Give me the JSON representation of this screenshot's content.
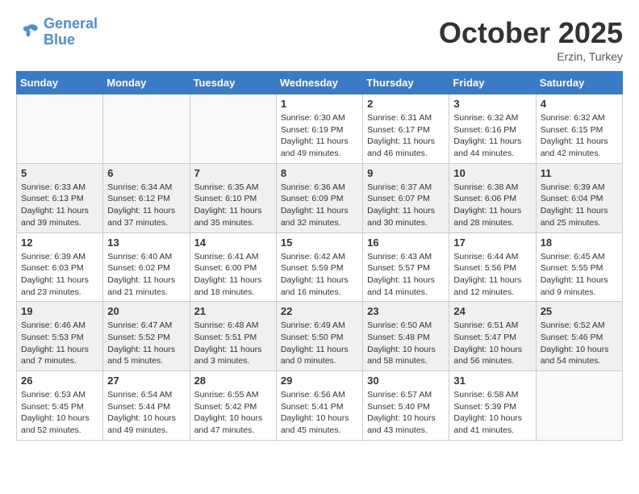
{
  "header": {
    "logo_line1": "General",
    "logo_line2": "Blue",
    "month": "October 2025",
    "location": "Erzin, Turkey"
  },
  "weekdays": [
    "Sunday",
    "Monday",
    "Tuesday",
    "Wednesday",
    "Thursday",
    "Friday",
    "Saturday"
  ],
  "weeks": [
    [
      {
        "day": "",
        "info": ""
      },
      {
        "day": "",
        "info": ""
      },
      {
        "day": "",
        "info": ""
      },
      {
        "day": "1",
        "info": "Sunrise: 6:30 AM\nSunset: 6:19 PM\nDaylight: 11 hours\nand 49 minutes."
      },
      {
        "day": "2",
        "info": "Sunrise: 6:31 AM\nSunset: 6:17 PM\nDaylight: 11 hours\nand 46 minutes."
      },
      {
        "day": "3",
        "info": "Sunrise: 6:32 AM\nSunset: 6:16 PM\nDaylight: 11 hours\nand 44 minutes."
      },
      {
        "day": "4",
        "info": "Sunrise: 6:32 AM\nSunset: 6:15 PM\nDaylight: 11 hours\nand 42 minutes."
      }
    ],
    [
      {
        "day": "5",
        "info": "Sunrise: 6:33 AM\nSunset: 6:13 PM\nDaylight: 11 hours\nand 39 minutes."
      },
      {
        "day": "6",
        "info": "Sunrise: 6:34 AM\nSunset: 6:12 PM\nDaylight: 11 hours\nand 37 minutes."
      },
      {
        "day": "7",
        "info": "Sunrise: 6:35 AM\nSunset: 6:10 PM\nDaylight: 11 hours\nand 35 minutes."
      },
      {
        "day": "8",
        "info": "Sunrise: 6:36 AM\nSunset: 6:09 PM\nDaylight: 11 hours\nand 32 minutes."
      },
      {
        "day": "9",
        "info": "Sunrise: 6:37 AM\nSunset: 6:07 PM\nDaylight: 11 hours\nand 30 minutes."
      },
      {
        "day": "10",
        "info": "Sunrise: 6:38 AM\nSunset: 6:06 PM\nDaylight: 11 hours\nand 28 minutes."
      },
      {
        "day": "11",
        "info": "Sunrise: 6:39 AM\nSunset: 6:04 PM\nDaylight: 11 hours\nand 25 minutes."
      }
    ],
    [
      {
        "day": "12",
        "info": "Sunrise: 6:39 AM\nSunset: 6:03 PM\nDaylight: 11 hours\nand 23 minutes."
      },
      {
        "day": "13",
        "info": "Sunrise: 6:40 AM\nSunset: 6:02 PM\nDaylight: 11 hours\nand 21 minutes."
      },
      {
        "day": "14",
        "info": "Sunrise: 6:41 AM\nSunset: 6:00 PM\nDaylight: 11 hours\nand 18 minutes."
      },
      {
        "day": "15",
        "info": "Sunrise: 6:42 AM\nSunset: 5:59 PM\nDaylight: 11 hours\nand 16 minutes."
      },
      {
        "day": "16",
        "info": "Sunrise: 6:43 AM\nSunset: 5:57 PM\nDaylight: 11 hours\nand 14 minutes."
      },
      {
        "day": "17",
        "info": "Sunrise: 6:44 AM\nSunset: 5:56 PM\nDaylight: 11 hours\nand 12 minutes."
      },
      {
        "day": "18",
        "info": "Sunrise: 6:45 AM\nSunset: 5:55 PM\nDaylight: 11 hours\nand 9 minutes."
      }
    ],
    [
      {
        "day": "19",
        "info": "Sunrise: 6:46 AM\nSunset: 5:53 PM\nDaylight: 11 hours\nand 7 minutes."
      },
      {
        "day": "20",
        "info": "Sunrise: 6:47 AM\nSunset: 5:52 PM\nDaylight: 11 hours\nand 5 minutes."
      },
      {
        "day": "21",
        "info": "Sunrise: 6:48 AM\nSunset: 5:51 PM\nDaylight: 11 hours\nand 3 minutes."
      },
      {
        "day": "22",
        "info": "Sunrise: 6:49 AM\nSunset: 5:50 PM\nDaylight: 11 hours\nand 0 minutes."
      },
      {
        "day": "23",
        "info": "Sunrise: 6:50 AM\nSunset: 5:48 PM\nDaylight: 10 hours\nand 58 minutes."
      },
      {
        "day": "24",
        "info": "Sunrise: 6:51 AM\nSunset: 5:47 PM\nDaylight: 10 hours\nand 56 minutes."
      },
      {
        "day": "25",
        "info": "Sunrise: 6:52 AM\nSunset: 5:46 PM\nDaylight: 10 hours\nand 54 minutes."
      }
    ],
    [
      {
        "day": "26",
        "info": "Sunrise: 6:53 AM\nSunset: 5:45 PM\nDaylight: 10 hours\nand 52 minutes."
      },
      {
        "day": "27",
        "info": "Sunrise: 6:54 AM\nSunset: 5:44 PM\nDaylight: 10 hours\nand 49 minutes."
      },
      {
        "day": "28",
        "info": "Sunrise: 6:55 AM\nSunset: 5:42 PM\nDaylight: 10 hours\nand 47 minutes."
      },
      {
        "day": "29",
        "info": "Sunrise: 6:56 AM\nSunset: 5:41 PM\nDaylight: 10 hours\nand 45 minutes."
      },
      {
        "day": "30",
        "info": "Sunrise: 6:57 AM\nSunset: 5:40 PM\nDaylight: 10 hours\nand 43 minutes."
      },
      {
        "day": "31",
        "info": "Sunrise: 6:58 AM\nSunset: 5:39 PM\nDaylight: 10 hours\nand 41 minutes."
      },
      {
        "day": "",
        "info": ""
      }
    ]
  ]
}
